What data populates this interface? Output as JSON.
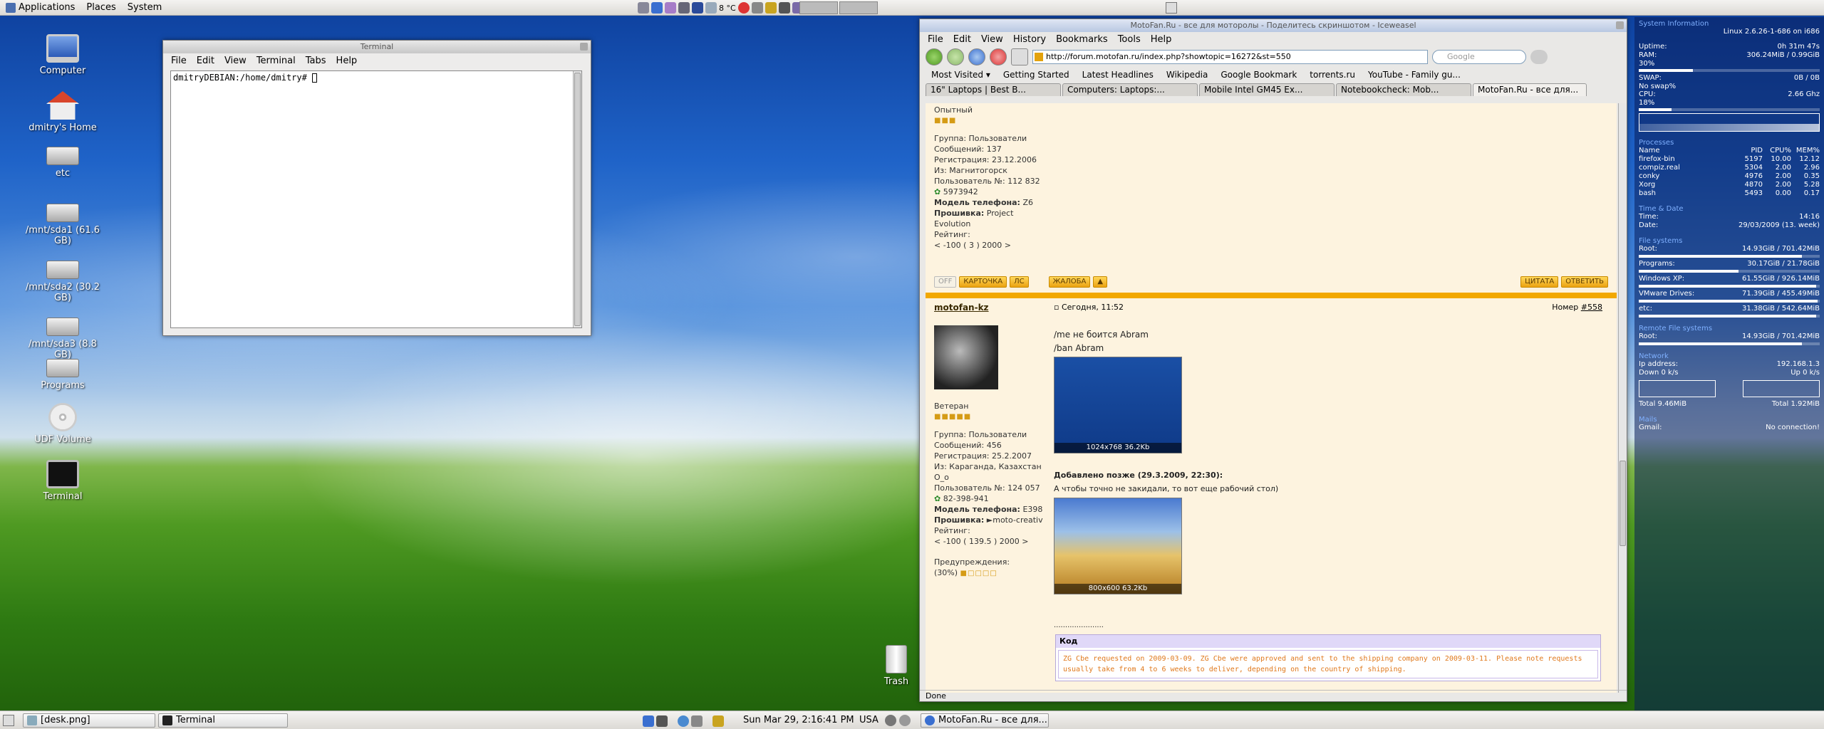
{
  "top_panel": {
    "menus": [
      "Applications",
      "Places",
      "System"
    ],
    "weather": "8 °C"
  },
  "desktop_icons": [
    {
      "label": "Computer",
      "icon": "computer-icon"
    },
    {
      "label": "dmitry's Home",
      "icon": "home-folder-icon"
    },
    {
      "label": "etc",
      "icon": "drive-icon"
    },
    {
      "label": "/mnt/sda1 (61.6 GB)",
      "icon": "drive-icon"
    },
    {
      "label": "/mnt/sda2 (30.2 GB)",
      "icon": "drive-icon"
    },
    {
      "label": "/mnt/sda3 (8.8 GB)",
      "icon": "drive-icon"
    },
    {
      "label": "Programs",
      "icon": "drive-icon"
    },
    {
      "label": "UDF Volume",
      "icon": "dvd-icon"
    },
    {
      "label": "Terminal",
      "icon": "terminal-icon"
    },
    {
      "label": "Trash",
      "icon": "trash-icon"
    }
  ],
  "terminal": {
    "title": "Terminal",
    "menus": [
      "File",
      "Edit",
      "View",
      "Terminal",
      "Tabs",
      "Help"
    ],
    "prompt": "dmitryDEBIAN:/home/dmitry#"
  },
  "browser": {
    "title": "MotoFan.Ru - все для моторолы - Поделитесь скриншотом - Iceweasel",
    "menus": [
      "File",
      "Edit",
      "View",
      "History",
      "Bookmarks",
      "Tools",
      "Help"
    ],
    "url": "http://forum.motofan.ru/index.php?showtopic=16272&st=550",
    "search_placeholder": "Google",
    "bookmarks": [
      "Most Visited ▾",
      "Getting Started",
      "Latest Headlines",
      "Wikipedia",
      "Google Bookmark",
      "torrents.ru",
      "YouTube - Family gu..."
    ],
    "tabs": [
      "16\" Laptops | Best B...",
      "Computers: Laptops:...",
      "Mobile Intel GM45 Ex...",
      "Notebookcheck: Mob...",
      "MotoFan.Ru - все для..."
    ],
    "status": "Done",
    "post1": {
      "rank": "Опытный",
      "group": "Группа: Пользователи",
      "messages": "Сообщений: 137",
      "registered": "Регистрация: 23.12.2006",
      "from": "Из: Магнитогорск",
      "user_no": "Пользователь №: 112 832",
      "icq": "5973942",
      "phone_label": "Модель телефона:",
      "phone": "Z6",
      "firmware_label": "Прошивка:",
      "firmware": "Project Evolution",
      "rating": "Рейтинг:",
      "rating_val": "< -100 ( 3 ) 2000 >"
    },
    "actions1": {
      "off": "OFF",
      "card": "КАРТОЧКА",
      "pm": "ЛС",
      "complaint": "ЖАЛОБА",
      "quote": "ЦИТАТА",
      "reply": "ОТВЕТИТЬ"
    },
    "post2": {
      "author": "motofan-kz",
      "date": "Сегодня, 11:52",
      "number_label": "Номер",
      "number": "#558",
      "line1": "/me не боится Abram",
      "line2": "/ban Abram",
      "img1_caption": "1024x768 36.2Kb",
      "added": "Добавлено позже (29.3.2009, 22:30):",
      "added_text": "А чтобы точно не закидали, то вот еще рабочий стол)",
      "img2_caption": "800x600 63.2Kb",
      "dots": "......................",
      "code_label": "Код",
      "code_text": "ZG Cbe requested on 2009-03-09. ZG Cbe were approved and sent to the shipping company on 2009-03-11. Please note requests usually take from 4 to 6 weeks to deliver, depending on the country of shipping.",
      "rank": "Ветеран",
      "group": "Группа: Пользователи",
      "messages": "Сообщений: 456",
      "registered": "Регистрация: 25.2.2007",
      "from": "Из: Караганда, Казахстан O_o",
      "user_no": "Пользователь №: 124 057",
      "icq": "82-398-941",
      "phone_label": "Модель телефона:",
      "phone": "E398",
      "firmware_label": "Прошивка:",
      "firmware": "►moto-creativ",
      "rating": "Рейтинг:",
      "rating_val": "< -100 ( 139.5 ) 2000 >",
      "warnings": "Предупреждения:",
      "warn_val": "(30%)"
    }
  },
  "conky": {
    "header": "System Information",
    "kernel": "Linux 2.6.26-1-686 on i686",
    "uptime": "0h 31m 47s",
    "ram": "306.24MiB / 0.99GiB",
    "ram_pct": "30%",
    "ram_frac": 0.3,
    "swap": "0B / 0B",
    "no_swap": "No swap%",
    "cpu": "2.66 Ghz",
    "cpu_pct": "18%",
    "cpu_frac": 0.18,
    "proc_header": "Processes",
    "proc_cols": [
      "Name",
      "PID",
      "CPU%",
      "MEM%"
    ],
    "procs": [
      [
        "firefox-bin",
        "5197",
        "10.00",
        "12.12"
      ],
      [
        "compiz.real",
        "5304",
        "2.00",
        "2.96"
      ],
      [
        "conky",
        "4976",
        "2.00",
        "0.35"
      ],
      [
        "Xorg",
        "4870",
        "2.00",
        "5.28"
      ],
      [
        "bash",
        "5493",
        "0.00",
        "0.17"
      ]
    ],
    "time_header": "Time & Date",
    "time": "14:16",
    "date": "29/03/2009 (13. week)",
    "fs_header": "File systems",
    "fs": [
      [
        "Root:",
        "14.93GiB / 701.42MiB",
        0.9
      ],
      [
        "Programs:",
        "30.17GiB / 21.78GiB",
        0.55
      ],
      [
        "Windows XP:",
        "61.55GiB / 926.14MiB",
        0.98
      ],
      [
        "VMware Drives:",
        "71.39GiB / 455.49MiB",
        0.99
      ],
      [
        "etc:",
        "31.38GiB / 542.64MiB",
        0.98
      ]
    ],
    "rfs_header": "Remote File systems",
    "rfs": [
      [
        "Root:",
        "14.93GiB / 701.42MiB",
        0.9
      ]
    ],
    "net_header": "Network",
    "ip_label": "Ip address:",
    "ip": "192.168.1.3",
    "down": "Down 0 k/s",
    "up": "Up 0 k/s",
    "total_down": "Total 9.46MiB",
    "total_up": "Total 1.92MiB",
    "mail_header": "Mails",
    "gmail_label": "Gmail:",
    "gmail": "No connection!"
  },
  "bottom_panel": {
    "tasks": [
      "[desk.png]",
      "Terminal"
    ],
    "clock": "Sun Mar 29,  2:16:41 PM",
    "layout": "USA",
    "browser_task": "MotoFan.Ru - все для..."
  }
}
